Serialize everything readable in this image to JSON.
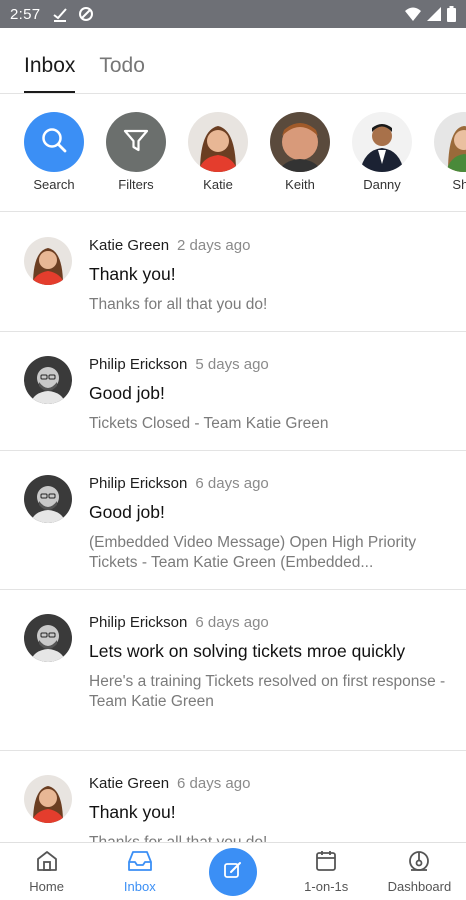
{
  "status_bar": {
    "time": "2:57",
    "icons": [
      "check-download-icon",
      "data-saver-icon",
      "wifi-icon",
      "signal-icon",
      "battery-icon"
    ]
  },
  "tabs": [
    {
      "label": "Inbox",
      "active": true
    },
    {
      "label": "Todo",
      "active": false
    }
  ],
  "filters": [
    {
      "label": "Search",
      "icon": "search-icon"
    },
    {
      "label": "Filters",
      "icon": "filter-icon"
    },
    {
      "label": "Katie"
    },
    {
      "label": "Keith"
    },
    {
      "label": "Danny"
    },
    {
      "label": "She"
    }
  ],
  "messages": [
    {
      "sender": "Katie Green",
      "time": "2 days ago",
      "title": "Thank you!",
      "preview": "Thanks for all that you do!"
    },
    {
      "sender": "Philip Erickson",
      "time": "5 days ago",
      "title": "Good job!",
      "preview": "Tickets Closed  - Team Katie Green"
    },
    {
      "sender": "Philip Erickson",
      "time": "6 days ago",
      "title": "Good job!",
      "preview": "(Embedded Video Message) Open High Priority Tickets - Team Katie Green (Embedded..."
    },
    {
      "sender": "Philip Erickson",
      "time": "6 days ago",
      "title": "Lets work on solving tickets mroe quickly",
      "preview": "Here's a training Tickets resolved on first response - Team Katie Green"
    },
    {
      "sender": "Katie Green",
      "time": "6 days ago",
      "title": "Thank you!",
      "preview": "Thanks for all that you do!"
    }
  ],
  "bottom_nav": [
    {
      "label": "Home",
      "icon": "home-icon"
    },
    {
      "label": "Inbox",
      "icon": "inbox-icon",
      "active": true
    },
    {
      "label": "",
      "icon": "compose-icon"
    },
    {
      "label": "1-on-1s",
      "icon": "calendar-icon"
    },
    {
      "label": "Dashboard",
      "icon": "dashboard-icon"
    }
  ],
  "colors": {
    "accent": "#3b8ff5",
    "status_bar": "#6e7076",
    "filter_gray": "#6b6f6d"
  }
}
